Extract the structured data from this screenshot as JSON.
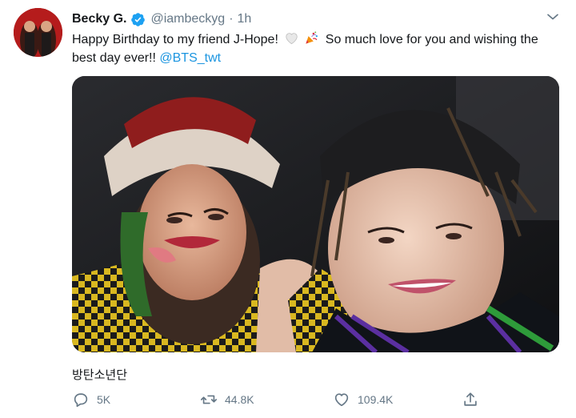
{
  "author": {
    "display_name": "Becky G.",
    "handle": "@iambeckyg",
    "separator": "·",
    "time": "1h",
    "verified_icon": "verified-badge-icon"
  },
  "tweet": {
    "text_part1": "Happy Birthday to my friend J-Hope! ",
    "text_part2": " So much love for you and wishing the best day ever!! ",
    "mention": "@BTS_twt",
    "emojis": [
      "white-heart-icon",
      "party-popper-icon"
    ]
  },
  "translation_text": "방탄소년단",
  "actions": {
    "reply_count": "5K",
    "retweet_count": "44.8K",
    "like_count": "109.4K"
  },
  "colors": {
    "link": "#1b95e0",
    "muted": "#657786",
    "text": "#14171a"
  }
}
